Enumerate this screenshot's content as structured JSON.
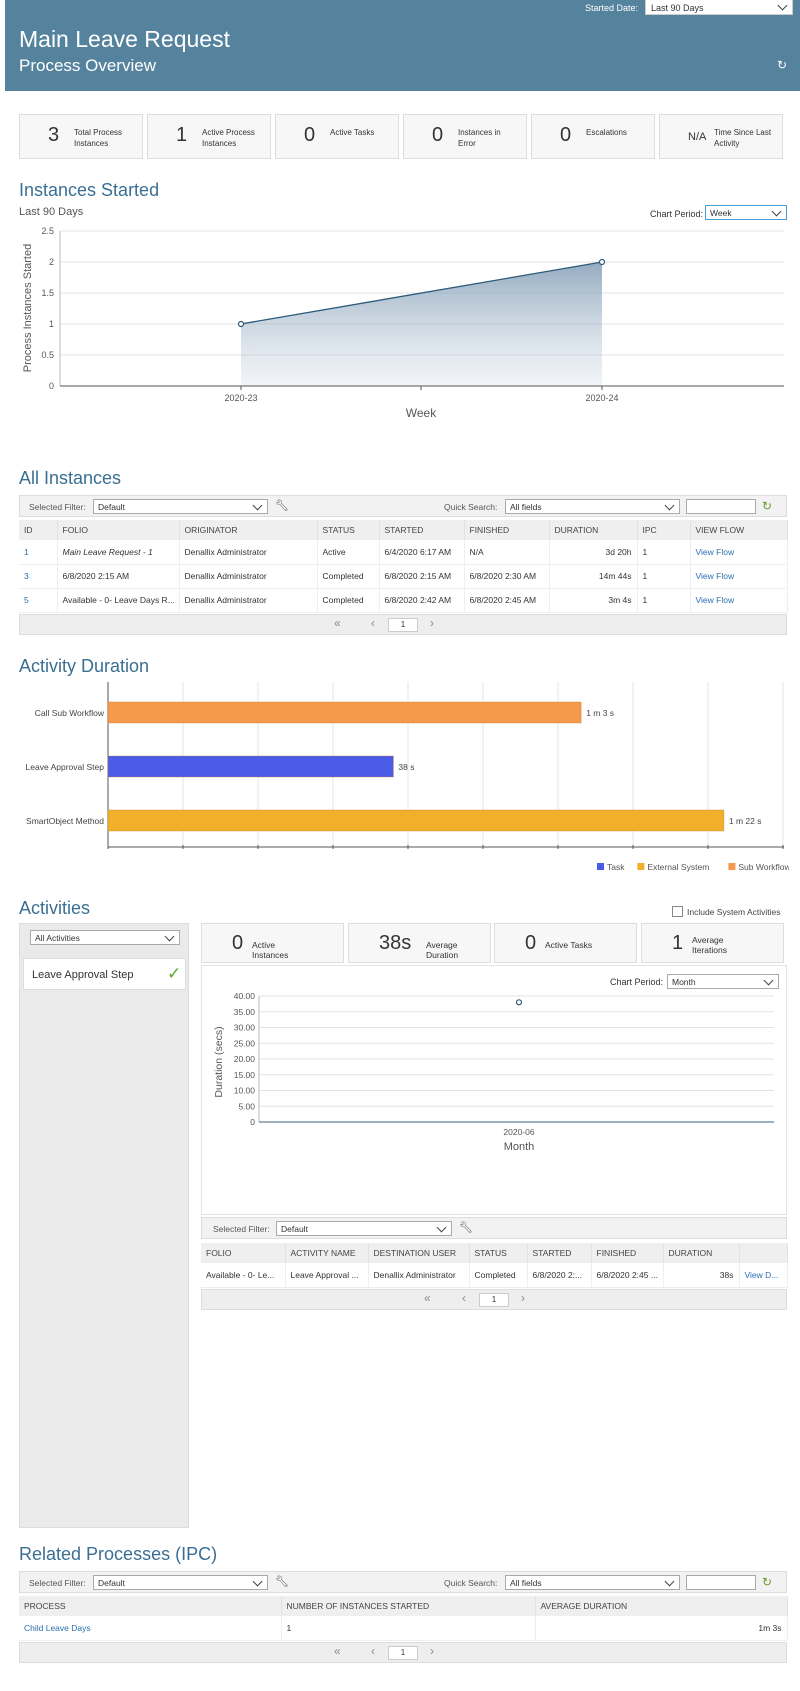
{
  "header": {
    "title": "Main Leave Request",
    "subtitle": "Process Overview",
    "started_date_label": "Started Date:",
    "started_date_value": "Last 90 Days"
  },
  "kpis": [
    {
      "num": "3",
      "label": "Total Process Instances"
    },
    {
      "num": "1",
      "label": "Active Process Instances"
    },
    {
      "num": "0",
      "label": "Active Tasks"
    },
    {
      "num": "0",
      "label": "Instances in Error"
    },
    {
      "num": "0",
      "label": "Escalations"
    },
    {
      "num": "N/A",
      "label": "Time Since Last Activity"
    }
  ],
  "instances_started": {
    "title": "Instances Started",
    "subtitle": "Last 90 Days",
    "period_label": "Chart Period:",
    "period_value": "Week"
  },
  "all_instances": {
    "title": "All Instances",
    "filter_label": "Selected Filter:",
    "filter_value": "Default",
    "search_label": "Quick Search:",
    "search_value": "All fields",
    "columns": [
      "ID",
      "FOLIO",
      "ORIGINATOR",
      "STATUS",
      "STARTED",
      "FINISHED",
      "DURATION",
      "IPC",
      "VIEW FLOW"
    ],
    "rows": [
      [
        "1",
        "Main Leave Request - 1",
        "Denallix Administrator",
        "Active",
        "6/4/2020 6:17 AM",
        "N/A",
        "3d 20h",
        "1",
        "View Flow"
      ],
      [
        "3",
        "6/8/2020 2:15 AM",
        "Denallix Administrator",
        "Completed",
        "6/8/2020 2:15 AM",
        "6/8/2020 2:30 AM",
        "14m 44s",
        "1",
        "View Flow"
      ],
      [
        "5",
        "Available - 0- Leave Days R...",
        "Denallix Administrator",
        "Completed",
        "6/8/2020 2:42 AM",
        "6/8/2020 2:45 AM",
        "3m 4s",
        "1",
        "View Flow"
      ]
    ],
    "page": "1"
  },
  "activity_duration": {
    "title": "Activity Duration",
    "legend": [
      {
        "name": "Task",
        "color": "#4a5be8"
      },
      {
        "name": "External System",
        "color": "#f2b02a"
      },
      {
        "name": "Sub Workflow",
        "color": "#f59a4a"
      }
    ]
  },
  "activities": {
    "title": "Activities",
    "include_label": "Include System Activities",
    "filter_value": "All Activities",
    "selected_item": "Leave Approval Step",
    "kpis": [
      {
        "num": "0",
        "label": "Active Instances"
      },
      {
        "num": "38s",
        "label": "Average Duration"
      },
      {
        "num": "0",
        "label": "Active Tasks"
      },
      {
        "num": "1",
        "label": "Average Iterations"
      }
    ],
    "period_label": "Chart Period:",
    "period_value": "Month",
    "filter_label": "Selected Filter:",
    "grid_filter": "Default",
    "columns": [
      "FOLIO",
      "ACTIVITY NAME",
      "DESTINATION USER",
      "STATUS",
      "STARTED",
      "FINISHED",
      "DURATION",
      ""
    ],
    "rows": [
      [
        "Available - 0- Le...",
        "Leave Approval ...",
        "Denallix Administrator",
        "Completed",
        "6/8/2020 2:...",
        "6/8/2020 2:45 ...",
        "38s",
        "View D..."
      ]
    ],
    "page": "1"
  },
  "related": {
    "title": "Related Processes (IPC)",
    "filter_label": "Selected Filter:",
    "filter_value": "Default",
    "search_label": "Quick Search:",
    "search_value": "All fields",
    "columns": [
      "PROCESS",
      "NUMBER OF INSTANCES STARTED",
      "AVERAGE DURATION"
    ],
    "rows": [
      [
        "Child Leave Days",
        "1",
        "1m 3s"
      ]
    ],
    "page": "1"
  },
  "chart_data": [
    {
      "type": "area",
      "title": "Instances Started",
      "xlabel": "Week",
      "ylabel": "Process Instances Started",
      "categories": [
        "2020-23",
        "2020-24"
      ],
      "values": [
        1,
        2
      ],
      "ylim": [
        0,
        2.5
      ],
      "yticks": [
        "0",
        "0.5",
        "1",
        "1.5",
        "2",
        "2.5"
      ]
    },
    {
      "type": "bar",
      "title": "Activity Duration",
      "orientation": "horizontal",
      "categories": [
        "Call Sub Workflow",
        "Leave Approval Step",
        "SmartObject Method"
      ],
      "values_seconds": [
        63,
        38,
        82
      ],
      "data_labels": [
        "1 m 3 s",
        "38 s",
        "1 m 22 s"
      ],
      "series_type": [
        "Sub Workflow",
        "Task",
        "External System"
      ],
      "xlim": [
        0,
        90
      ]
    },
    {
      "type": "scatter",
      "xlabel": "Month",
      "ylabel": "Duration (secs)",
      "categories": [
        "2020-06"
      ],
      "values": [
        38
      ],
      "ylim": [
        0,
        40
      ],
      "yticks": [
        "0",
        "5.00",
        "10.00",
        "15.00",
        "20.00",
        "25.00",
        "30.00",
        "35.00",
        "40.00"
      ]
    }
  ]
}
